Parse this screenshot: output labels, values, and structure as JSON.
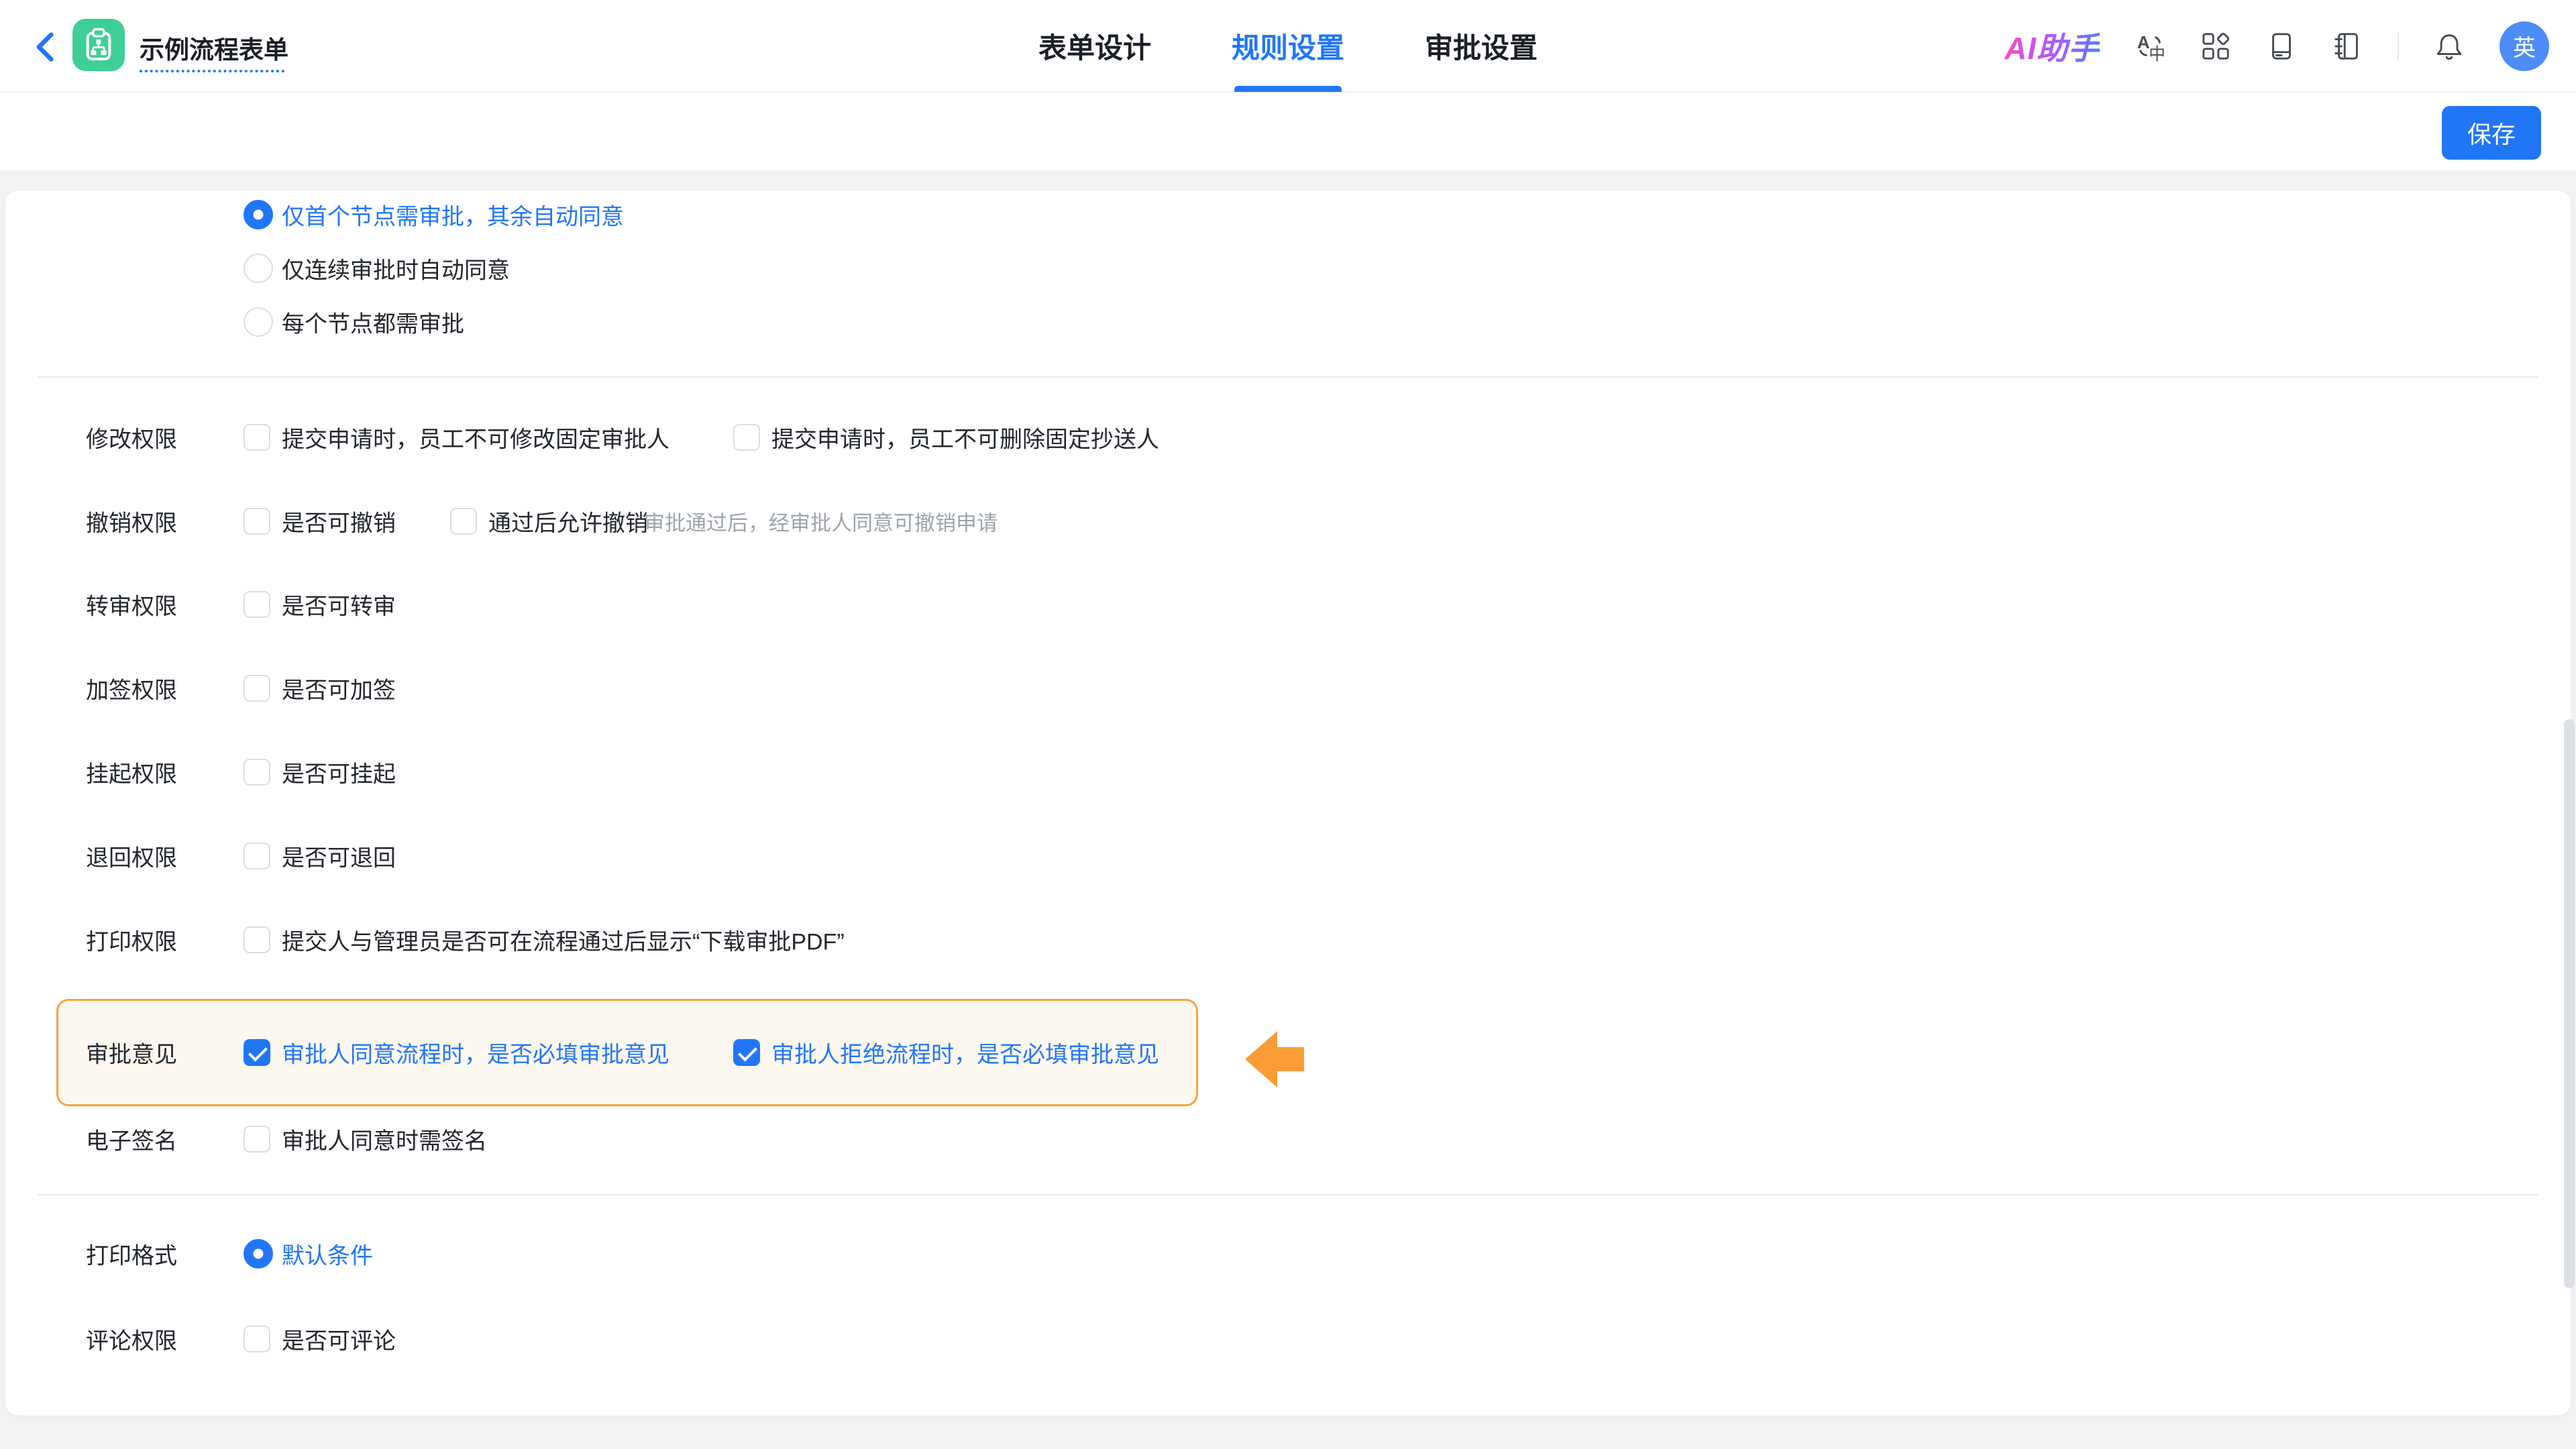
{
  "header": {
    "title": "示例流程表单",
    "tabs": [
      {
        "label": "表单设计",
        "active": false
      },
      {
        "label": "规则设置",
        "active": true
      },
      {
        "label": "审批设置",
        "active": false
      }
    ],
    "ai_label": "AI助手",
    "icons": [
      "translate-icon",
      "apps-grid-icon",
      "book-icon",
      "notebook-icon",
      "bell-icon"
    ],
    "avatar_text": "英"
  },
  "toolbar": {
    "save_label": "保存"
  },
  "content": {
    "approval_mode": [
      {
        "label": "仅首个节点需审批，其余自动同意",
        "selected": true
      },
      {
        "label": "仅连续审批时自动同意",
        "selected": false
      },
      {
        "label": "每个节点都需审批",
        "selected": false
      }
    ],
    "rows": {
      "modify": {
        "label": "修改权限",
        "opt1": "提交申请时，员工不可修改固定审批人",
        "opt1_checked": false,
        "opt2": "提交申请时，员工不可删除固定抄送人",
        "opt2_checked": false
      },
      "withdraw": {
        "label": "撤销权限",
        "opt1": "是否可撤销",
        "opt1_checked": false,
        "opt2": "通过后允许撤销",
        "opt2_checked": false,
        "hint": "审批通过后，经审批人同意可撤销申请"
      },
      "transfer": {
        "label": "转审权限",
        "opt": "是否可转审",
        "checked": false
      },
      "addsign": {
        "label": "加签权限",
        "opt": "是否可加签",
        "checked": false
      },
      "suspend": {
        "label": "挂起权限",
        "opt": "是否可挂起",
        "checked": false
      },
      "sendback": {
        "label": "退回权限",
        "opt": "是否可退回",
        "checked": false
      },
      "print": {
        "label": "打印权限",
        "opt": "提交人与管理员是否可在流程通过后显示“下载审批PDF”",
        "checked": false
      },
      "opinion": {
        "label": "审批意见",
        "opt1": "审批人同意流程时，是否必填审批意见",
        "opt1_checked": true,
        "opt2": "审批人拒绝流程时，是否必填审批意见",
        "opt2_checked": true,
        "highlighted": true
      },
      "signature": {
        "label": "电子签名",
        "opt": "审批人同意时需签名",
        "checked": false
      },
      "printformat": {
        "label": "打印格式",
        "opt": "默认条件",
        "selected": true
      },
      "comment": {
        "label": "评论权限",
        "opt": "是否可评论",
        "checked": false
      }
    }
  },
  "colors": {
    "accent_blue": "#2176F6",
    "app_icon_green": "#3DCF96",
    "highlight_orange": "#F9A23C",
    "highlight_bg": "#FCF8F0",
    "hint_gray": "#9CA3AC"
  }
}
